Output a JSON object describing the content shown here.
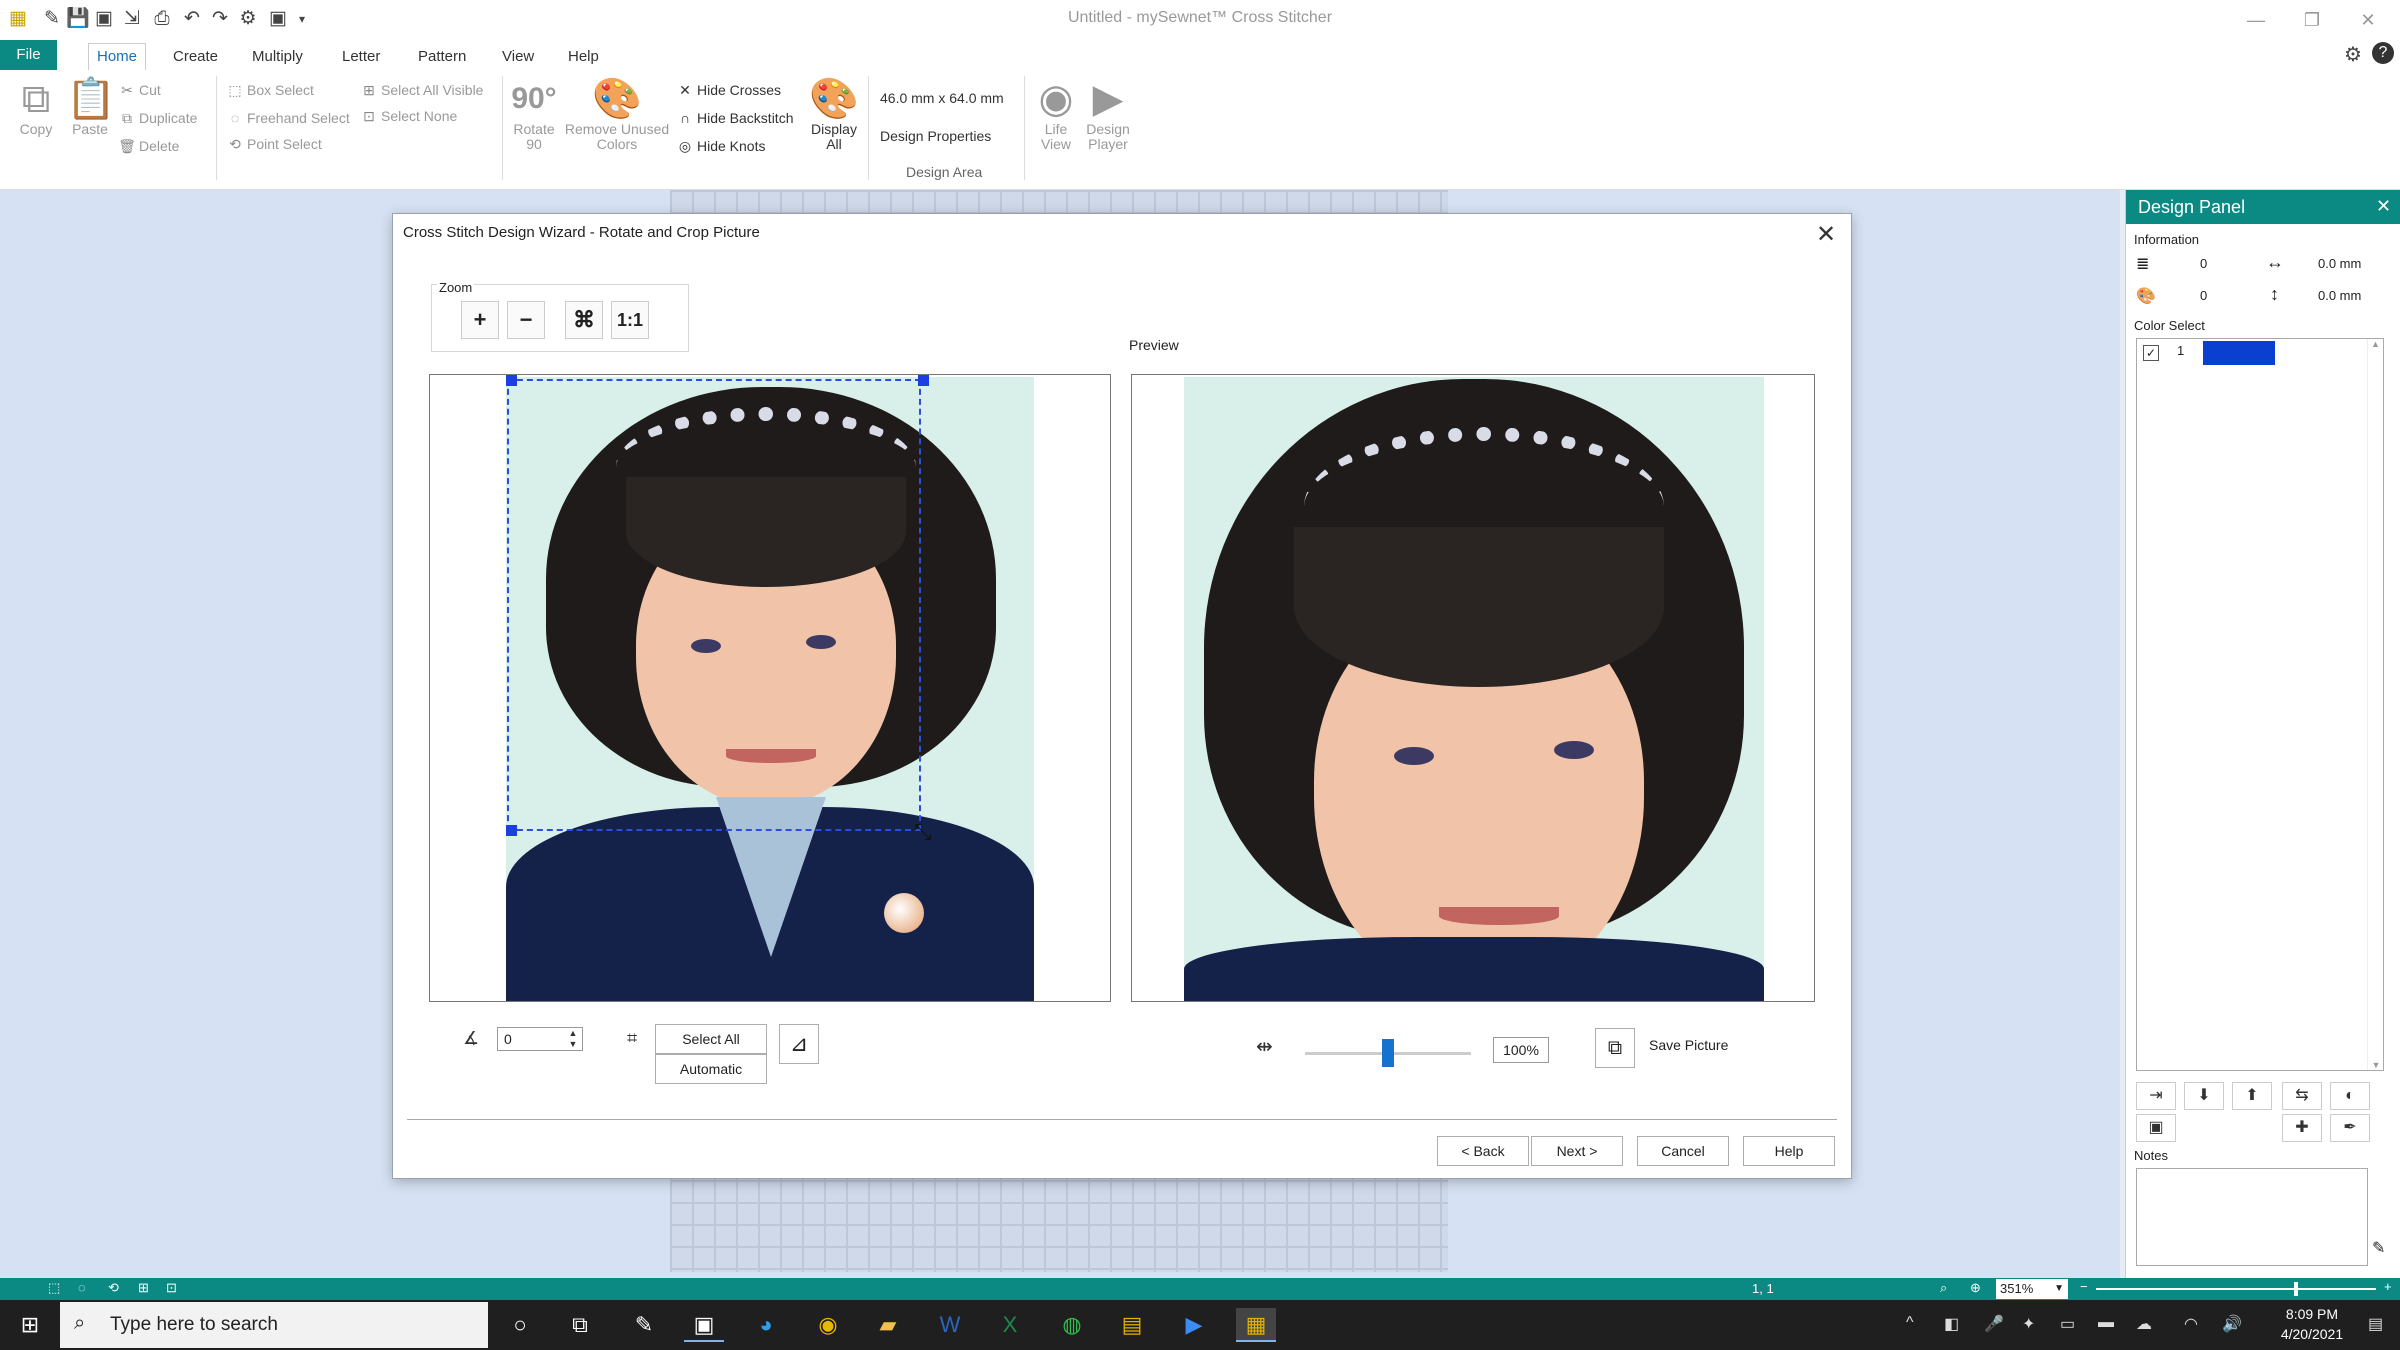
{
  "app": {
    "title": "Untitled - mySewnet™ Cross Stitcher"
  },
  "quick_access": [
    "app-logo-icon",
    "new-icon",
    "save-icon",
    "save-as-icon",
    "export-icon",
    "print-icon",
    "undo-icon",
    "redo-icon",
    "settings-icon",
    "player-icon",
    "customize-icon"
  ],
  "menu": {
    "file": "File",
    "tabs": [
      "Home",
      "Create",
      "Multiply",
      "Letter",
      "Pattern",
      "View",
      "Help"
    ]
  },
  "ribbon": {
    "clipboard": {
      "copy": "Copy",
      "paste": "Paste",
      "cut": "Cut",
      "duplicate": "Duplicate",
      "delete": "Delete"
    },
    "select": {
      "box": "Box Select",
      "freehand": "Freehand Select",
      "point": "Point Select",
      "all_visible": "Select All Visible",
      "none": "Select None"
    },
    "tools": {
      "rotate": "Rotate 90",
      "rotate_icon_text": "90°",
      "remove_unused": "Remove Unused Colors",
      "hide_crosses": "Hide Crosses",
      "hide_backstitch": "Hide Backstitch",
      "hide_knots": "Hide Knots",
      "display_all": "Display All"
    },
    "design_area": {
      "size": "46.0 mm x 64.0 mm",
      "properties": "Design Properties",
      "group_label": "Design Area"
    },
    "view": {
      "life_view": "Life View",
      "design_player": "Design Player"
    }
  },
  "dialog": {
    "title": "Cross Stitch Design Wizard - Rotate and Crop Picture",
    "zoom_label": "Zoom",
    "zoom_buttons": {
      "zoom_in": "+",
      "zoom_out": "−",
      "fit": "⌘",
      "one_to_one": "1:1"
    },
    "preview_label": "Preview",
    "rotate_value": "0",
    "select_all": "Select All",
    "automatic": "Automatic",
    "zoom_percent": "100%",
    "slider_level": 0.5,
    "save_picture": "Save Picture",
    "buttons": {
      "back": "< Back",
      "next": "Next >",
      "cancel": "Cancel",
      "help": "Help"
    }
  },
  "design_panel": {
    "title": "Design Panel",
    "information_label": "Information",
    "stitches": "0",
    "colors": "0",
    "width": "0.0 mm",
    "height": "0.0 mm",
    "color_select_label": "Color Select",
    "color_rows": [
      {
        "number": "1",
        "color": "#0b3fd0"
      }
    ],
    "notes_label": "Notes"
  },
  "status": {
    "position": "1, 1",
    "zoom": "351%"
  },
  "taskbar": {
    "search_placeholder": "Type here to search",
    "time": "8:09 PM",
    "date": "4/20/2021"
  }
}
